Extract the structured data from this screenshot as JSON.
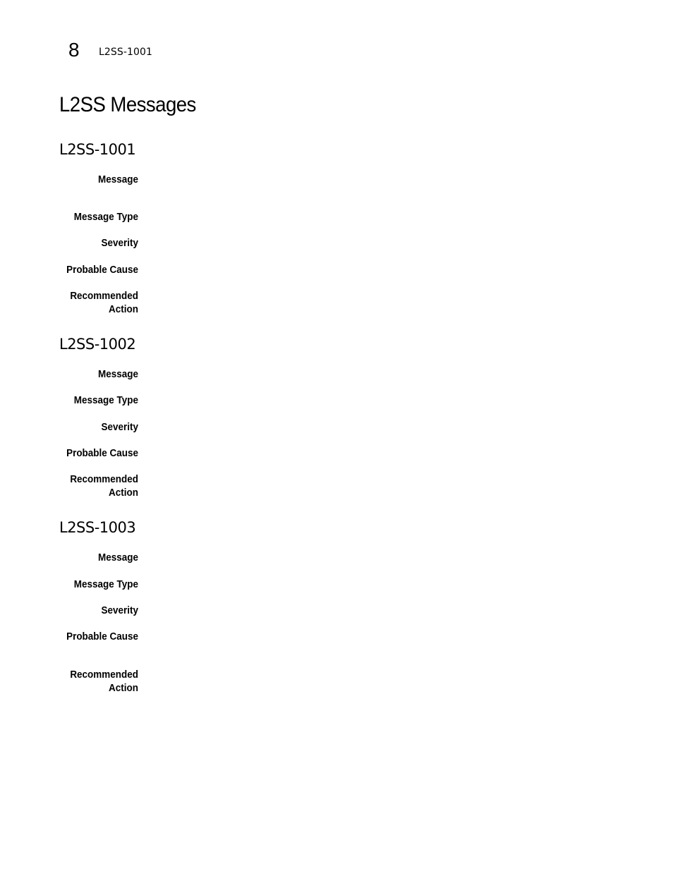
{
  "header": {
    "chapter_number": "8",
    "running_head": "L2SS-1001"
  },
  "page_title": "L2SS Messages",
  "sections": [
    {
      "title": "L2SS-1001",
      "fields": [
        {
          "label": "Message",
          "value": ""
        },
        {
          "label": "Message Type",
          "value": ""
        },
        {
          "label": "Severity",
          "value": ""
        },
        {
          "label": "Probable Cause",
          "value": ""
        },
        {
          "label": "Recommended Action",
          "value": ""
        }
      ]
    },
    {
      "title": "L2SS-1002",
      "fields": [
        {
          "label": "Message",
          "value": ""
        },
        {
          "label": "Message Type",
          "value": ""
        },
        {
          "label": "Severity",
          "value": ""
        },
        {
          "label": "Probable Cause",
          "value": ""
        },
        {
          "label": "Recommended Action",
          "value": ""
        }
      ]
    },
    {
      "title": "L2SS-1003",
      "fields": [
        {
          "label": "Message",
          "value": ""
        },
        {
          "label": "Message Type",
          "value": ""
        },
        {
          "label": "Severity",
          "value": ""
        },
        {
          "label": "Probable Cause",
          "value": ""
        },
        {
          "label": "Recommended Action",
          "value": ""
        }
      ]
    }
  ]
}
